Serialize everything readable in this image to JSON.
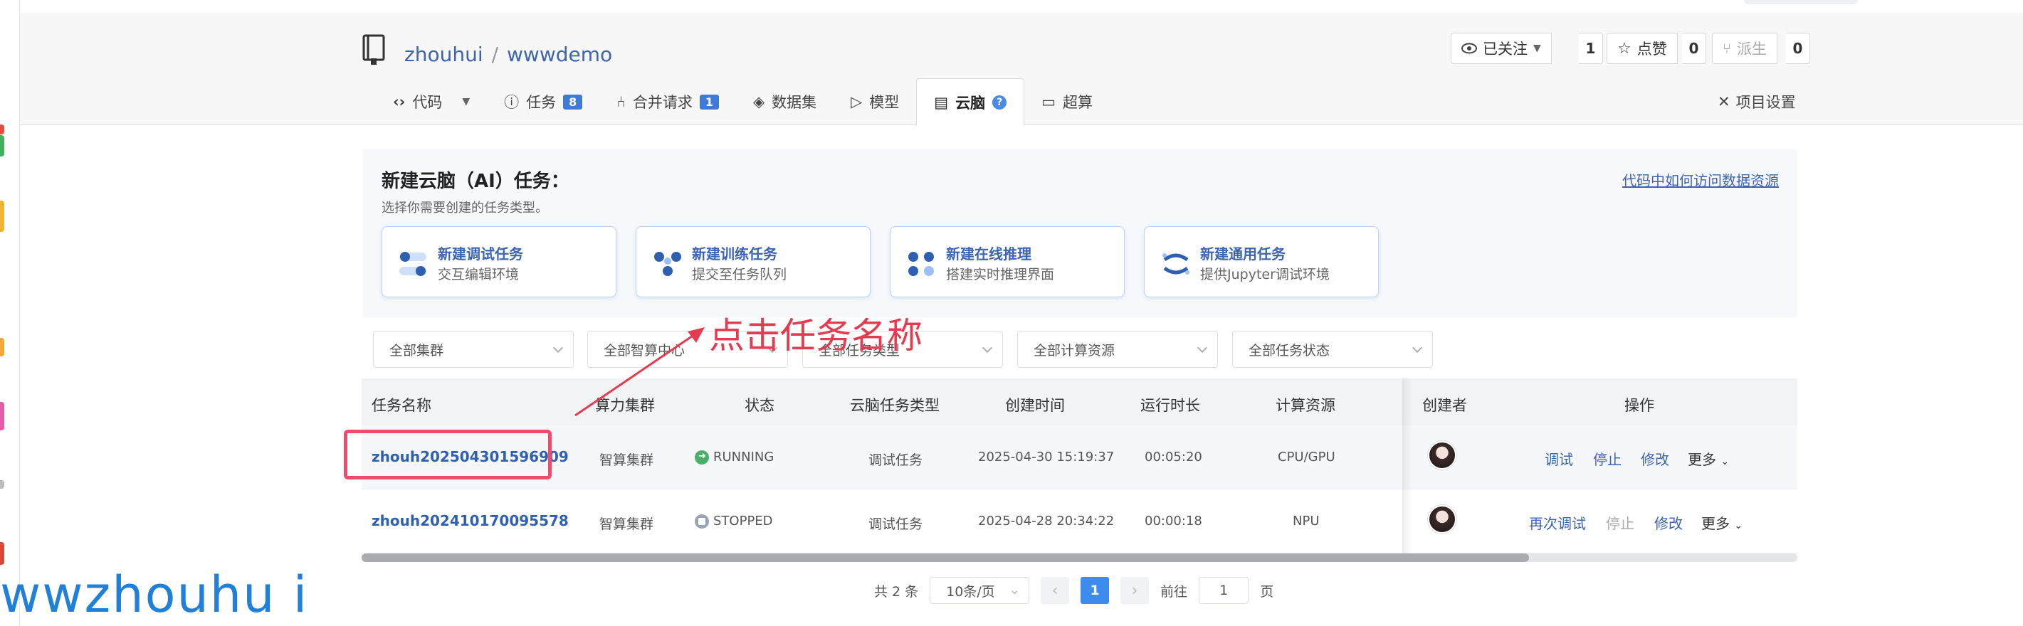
{
  "repo": {
    "owner": "zhouhui",
    "separator": "/",
    "name": "wwwdemo"
  },
  "header_buttons": {
    "watch": {
      "label": "已关注",
      "count": "1"
    },
    "star": {
      "label": "点赞",
      "count": "0"
    },
    "fork": {
      "label": "派生",
      "count": "0"
    }
  },
  "tabs": [
    {
      "label": "代码"
    },
    {
      "label": "任务",
      "badge": "8"
    },
    {
      "label": "合并请求",
      "badge": "1"
    },
    {
      "label": "数据集"
    },
    {
      "label": "模型"
    },
    {
      "label": "云脑"
    },
    {
      "label": "超算"
    }
  ],
  "settings_label": "项目设置",
  "create": {
    "title": "新建云脑（AI）任务：",
    "subtitle": "选择你需要创建的任务类型。",
    "help_link": "代码中如何访问数据资源",
    "cards": [
      {
        "title": "新建调试任务",
        "desc": "交互编辑环境"
      },
      {
        "title": "新建训练任务",
        "desc": "提交至任务队列"
      },
      {
        "title": "新建在线推理",
        "desc": "搭建实时推理界面"
      },
      {
        "title": "新建通用任务",
        "desc": "提供Jupyter调试环境"
      }
    ]
  },
  "filters": [
    "全部集群",
    "全部智算中心",
    "全部任务类型",
    "全部计算资源",
    "全部任务状态"
  ],
  "table": {
    "headers": [
      "任务名称",
      "算力集群",
      "状态",
      "云脑任务类型",
      "创建时间",
      "运行时长",
      "计算资源",
      "创建者",
      "操作"
    ],
    "rows": [
      {
        "name": "zhouh202504301596909",
        "cluster": "智算集群",
        "status": "RUNNING",
        "type": "调试任务",
        "created": "2025-04-30 15:19:37",
        "duration": "00:05:20",
        "resource": "CPU/GPU",
        "ops": [
          "调试",
          "停止",
          "修改",
          "更多"
        ]
      },
      {
        "name": "zhouh202410170095578",
        "cluster": "智算集群",
        "status": "STOPPED",
        "type": "调试任务",
        "created": "2025-04-28 20:34:22",
        "duration": "00:00:18",
        "resource": "NPU",
        "ops": [
          "再次调试",
          "停止",
          "修改",
          "更多"
        ]
      }
    ]
  },
  "pager": {
    "total": "共 2 条",
    "page_size": "10条/页",
    "prev": "‹",
    "current": "1",
    "next": "›",
    "goto_prefix": "前往",
    "goto_value": "1",
    "goto_suffix": "页"
  },
  "annotation": {
    "text": "点击任务名称"
  },
  "watermark": "wwzhouhu i",
  "colors": {
    "accent": "#3e7bd6",
    "annotation": "#e33b4f",
    "running": "#4cae6a",
    "stopped": "#9aa3b5"
  }
}
